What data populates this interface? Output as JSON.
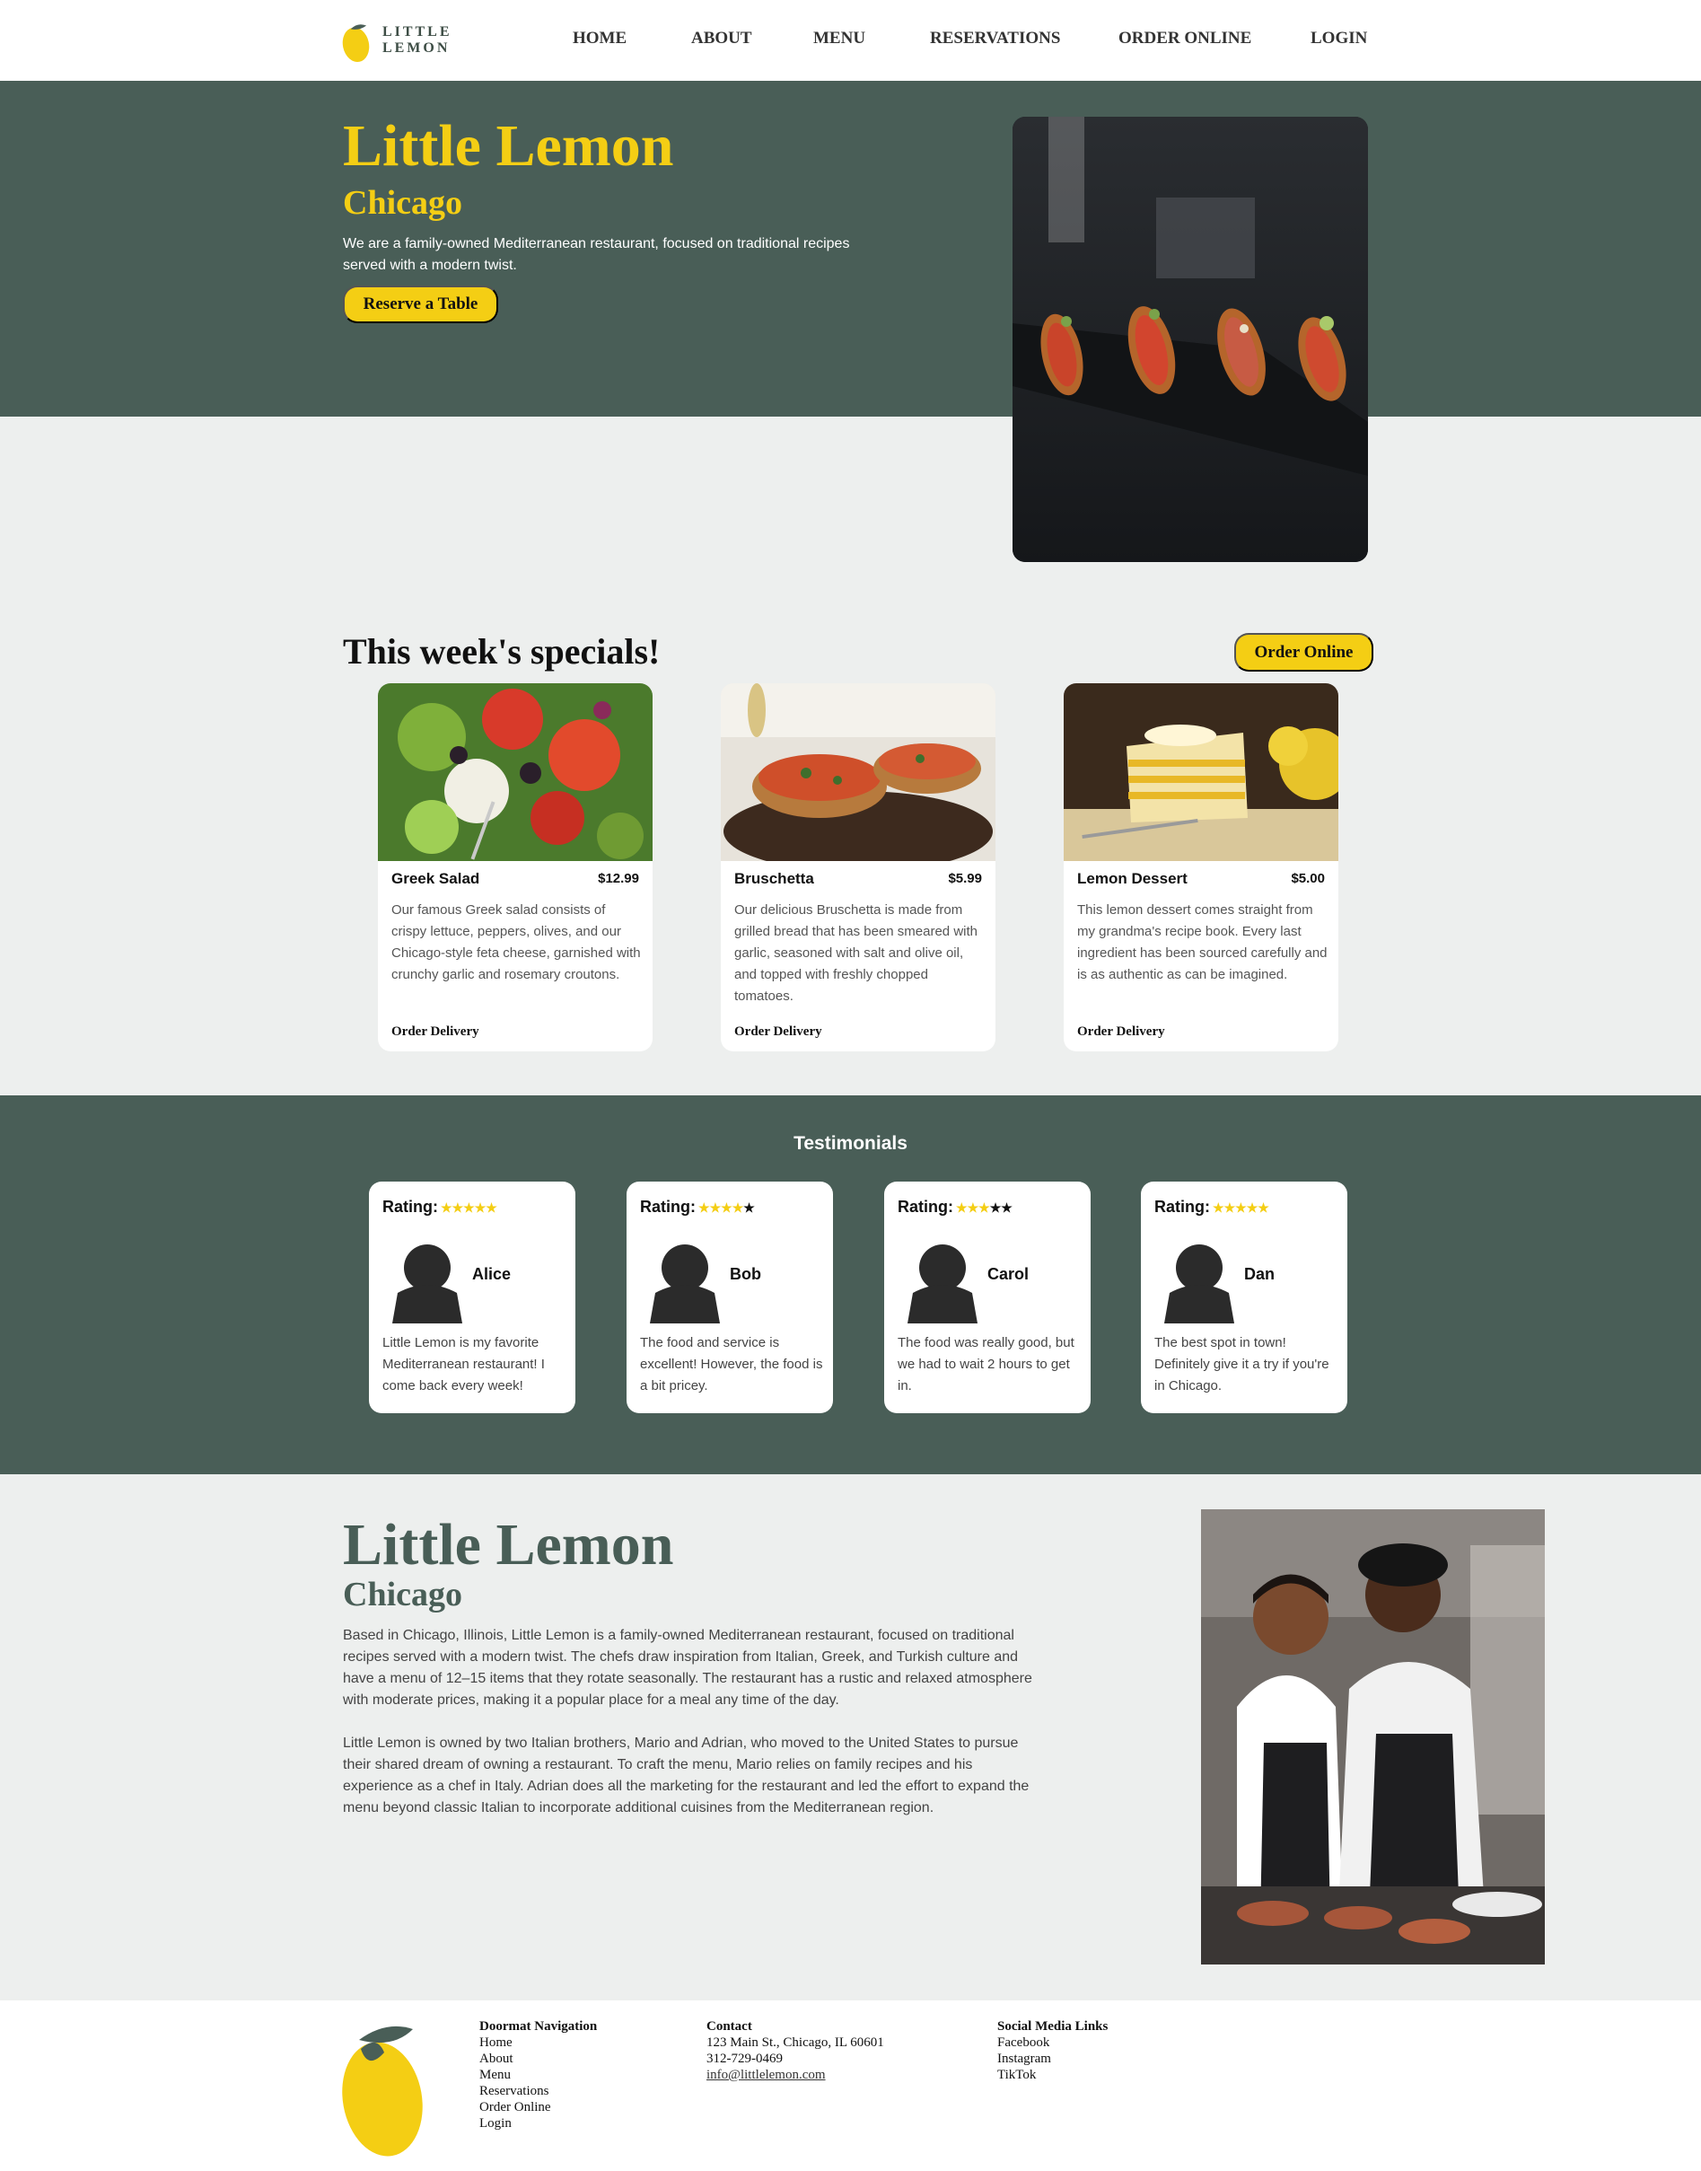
{
  "nav": {
    "logo_text": "LITTLE LEMON",
    "items": [
      "HOME",
      "ABOUT",
      "MENU",
      "RESERVATIONS",
      "ORDER ONLINE",
      "LOGIN"
    ]
  },
  "hero": {
    "title": "Little Lemon",
    "subtitle": "Chicago",
    "description": "We are a family-owned Mediterranean restaurant, focused on traditional recipes served with a modern twist.",
    "button": "Reserve a Table"
  },
  "specials": {
    "title": "This week's specials!",
    "button": "Order Online",
    "cards": [
      {
        "name": "Greek Salad",
        "price": "$12.99",
        "description": "Our famous Greek salad consists of crispy lettuce, peppers, olives, and our Chicago-style feta cheese, garnished with crunchy garlic and rosemary croutons.",
        "link": "Order Delivery"
      },
      {
        "name": "Bruschetta",
        "price": "$5.99",
        "description": "Our delicious Bruschetta is made from grilled bread that has been smeared with garlic, seasoned with salt and olive oil, and topped with freshly chopped tomatoes.",
        "link": "Order Delivery"
      },
      {
        "name": "Lemon Dessert",
        "price": "$5.00",
        "description": "This lemon dessert comes straight from my grandma's recipe book. Every last ingredient has been sourced carefully and is as authentic as can be imagined.",
        "link": "Order Delivery"
      }
    ]
  },
  "testimonials": {
    "title": "Testimonials",
    "rating_label": "Rating:",
    "items": [
      {
        "name": "Alice",
        "stars": 5,
        "text": "Little Lemon is my favorite Mediterranean restaurant! I come back every week!"
      },
      {
        "name": "Bob",
        "stars": 4,
        "text": "The food and service is excellent! However, the food is a bit pricey."
      },
      {
        "name": "Carol",
        "stars": 3,
        "text": "The food was really good, but we had to wait 2 hours to get in."
      },
      {
        "name": "Dan",
        "stars": 5,
        "text": "The best spot in town! Definitely give it a try if you're in Chicago."
      }
    ]
  },
  "about": {
    "title": "Little Lemon",
    "subtitle": "Chicago",
    "paragraph1": "Based in Chicago, Illinois, Little Lemon is a family-owned Mediterranean restaurant, focused on traditional recipes served with a modern twist. The chefs draw inspiration from Italian, Greek, and Turkish culture and have a menu of 12–15 items that they rotate seasonally. The restaurant has a rustic and relaxed atmosphere with moderate prices, making it a popular place for a meal any time of the day.",
    "paragraph2": "Little Lemon is owned by two Italian brothers, Mario and Adrian, who moved to the United States to pursue their shared dream of owning a restaurant. To craft the menu, Mario relies on family recipes and his experience as a chef in Italy. Adrian does all the marketing for the restaurant and led the effort to expand the menu beyond classic Italian to incorporate additional cuisines from the Mediterranean region."
  },
  "footer": {
    "nav_heading": "Doormat Navigation",
    "nav_links": [
      "Home",
      "About",
      "Menu",
      "Reservations",
      "Order Online",
      "Login"
    ],
    "contact_heading": "Contact",
    "address": "123 Main St., Chicago, IL 60601",
    "phone": "312-729-0469",
    "email": "info@littlelemon.com",
    "social_heading": "Social Media Links",
    "social_links": [
      "Facebook",
      "Instagram",
      "TikTok"
    ]
  },
  "colors": {
    "primary_green": "#495e57",
    "primary_yellow": "#f4ce14",
    "background": "#edefee"
  },
  "icons": [
    "lemon-logo-icon",
    "person-avatar-icon",
    "star-icon"
  ]
}
